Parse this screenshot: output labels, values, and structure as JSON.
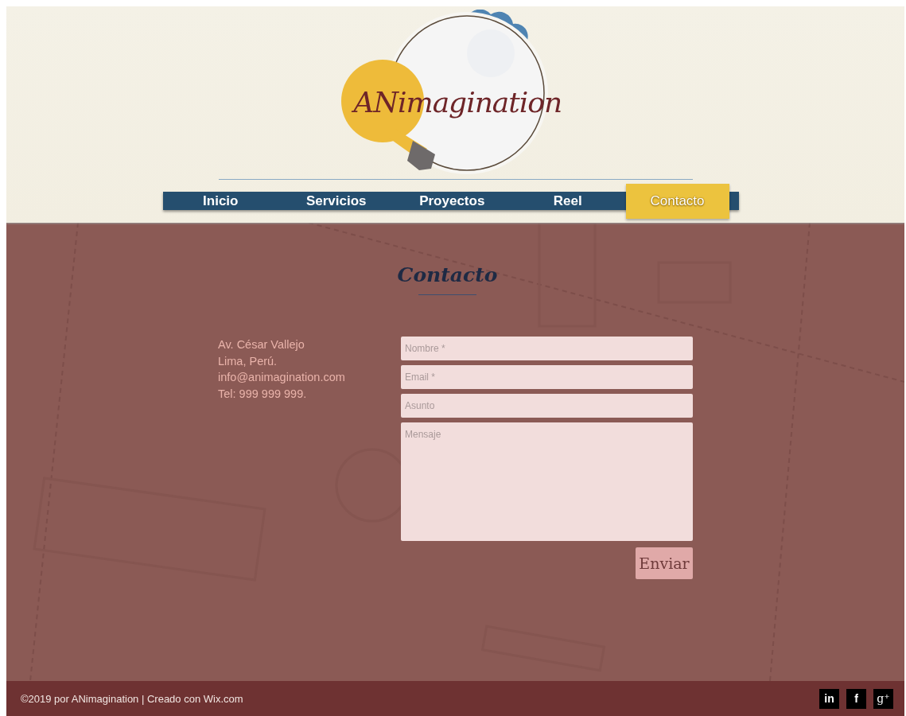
{
  "logo": {
    "text": "ANimagination"
  },
  "nav": [
    {
      "label": "Inicio",
      "selected": false
    },
    {
      "label": "Servicios",
      "selected": false
    },
    {
      "label": "Proyectos",
      "selected": false
    },
    {
      "label": "Reel",
      "selected": false
    },
    {
      "label": "Contacto",
      "selected": true
    }
  ],
  "contact": {
    "title": "Contacto",
    "address": [
      "Av. César Vallejo",
      "Lima, Perú.",
      "info@animagination.com",
      "Tel: 999 999 999."
    ],
    "fields": [
      {
        "placeholder": "Nombre *",
        "kind": "line"
      },
      {
        "placeholder": "Email *",
        "kind": "line"
      },
      {
        "placeholder": "Asunto",
        "kind": "line"
      },
      {
        "placeholder": "Mensaje",
        "kind": "area"
      }
    ],
    "submit": "Enviar"
  },
  "footer": {
    "text": "©2019 por ANimagination | Creado con Wix.com",
    "social": [
      {
        "label": "in",
        "kind": "linkedin"
      },
      {
        "label": "f",
        "kind": "facebook"
      },
      {
        "label": "g⁺",
        "kind": "googleplus"
      }
    ]
  }
}
